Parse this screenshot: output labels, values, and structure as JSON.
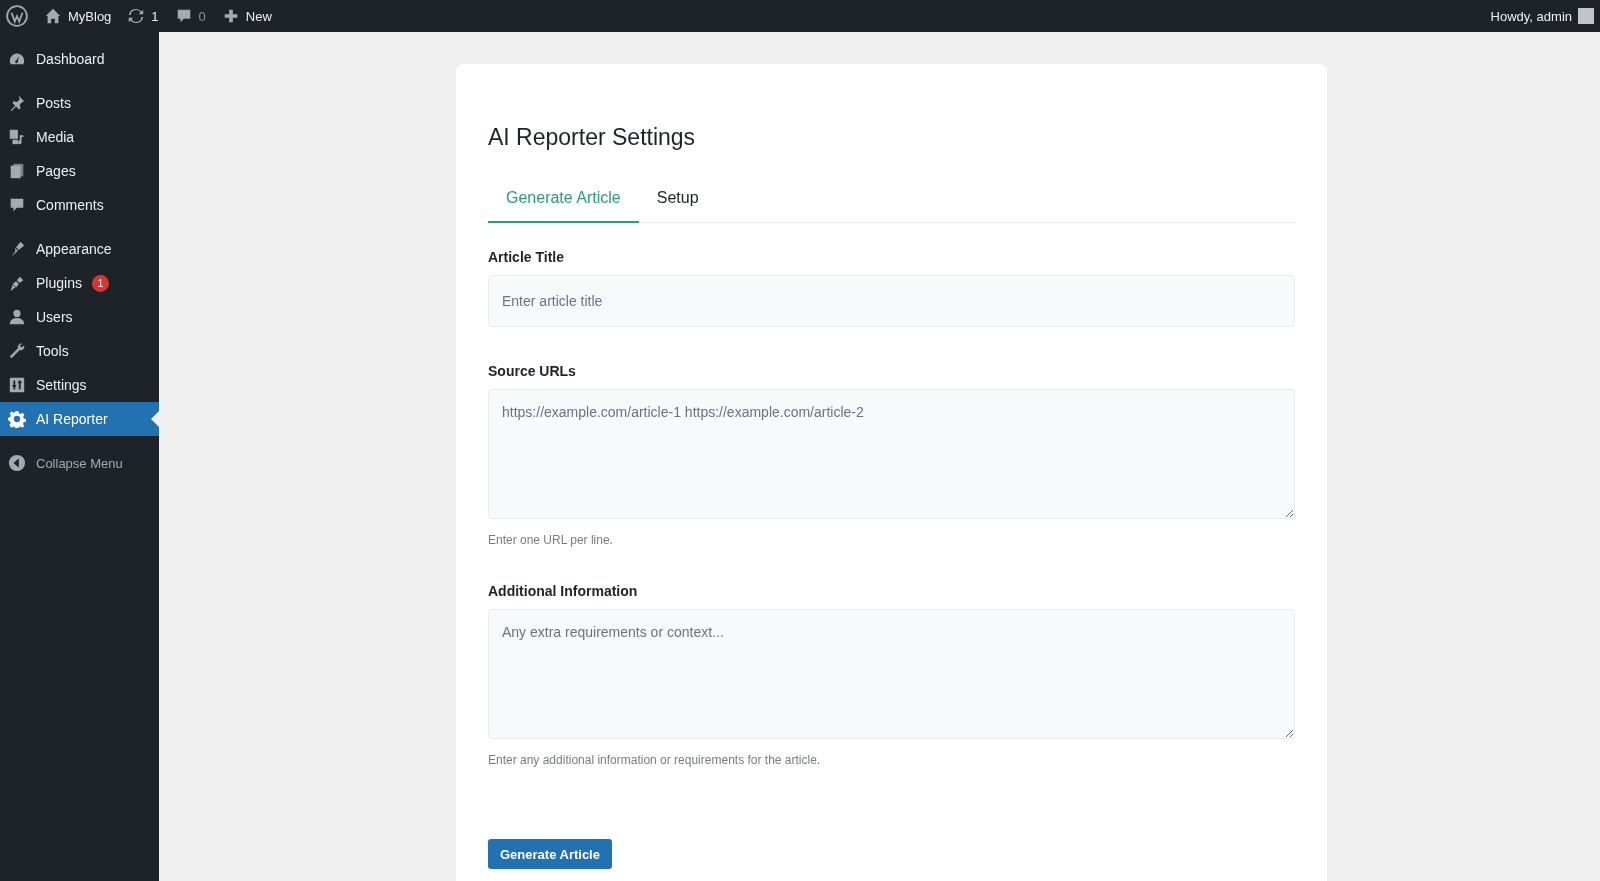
{
  "admin_bar": {
    "site_name": "MyBlog",
    "updates": "1",
    "comments": "0",
    "new_label": "New",
    "greeting": "Howdy, admin"
  },
  "sidebar": {
    "groups": [
      [
        {
          "label": "Dashboard",
          "selected": false
        }
      ],
      [
        {
          "label": "Posts",
          "selected": false
        },
        {
          "label": "Media",
          "selected": false
        },
        {
          "label": "Pages",
          "selected": false
        },
        {
          "label": "Comments",
          "selected": false
        }
      ],
      [
        {
          "label": "Appearance",
          "selected": false
        },
        {
          "label": "Plugins",
          "selected": false,
          "badge": "1"
        },
        {
          "label": "Users",
          "selected": false
        },
        {
          "label": "Tools",
          "selected": false
        },
        {
          "label": "Settings",
          "selected": false
        },
        {
          "label": "AI Reporter",
          "selected": true
        }
      ]
    ],
    "collapse_label": "Collapse Menu"
  },
  "page": {
    "title": "AI Reporter Settings",
    "tabs": [
      {
        "label": "Generate Article",
        "selected": true
      },
      {
        "label": "Setup",
        "selected": false
      }
    ],
    "fields": [
      {
        "kind": "input",
        "label": "Article Title",
        "placeholder": "Enter article title"
      },
      {
        "kind": "textarea",
        "label": "Source URLs",
        "placeholder": "https://example.com/article-1 https://example.com/article-2",
        "help": "Enter one URL per line."
      },
      {
        "kind": "textarea",
        "label": "Additional Information",
        "placeholder": "Any extra requirements or context...",
        "help": "Enter any additional information or requirements for the article."
      }
    ],
    "submit_label": "Generate Article"
  }
}
